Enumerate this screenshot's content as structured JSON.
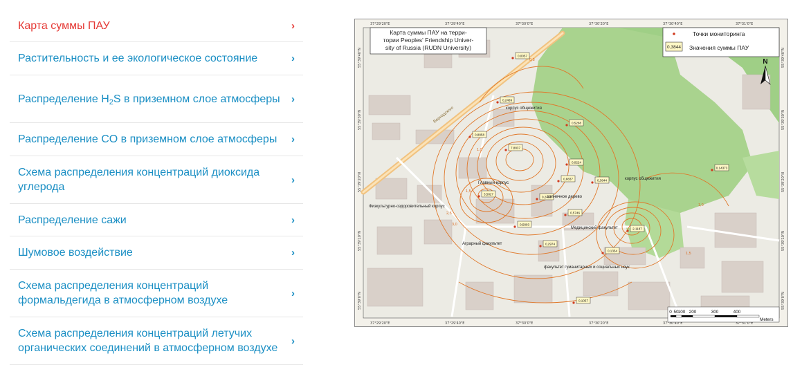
{
  "menu": [
    {
      "label": "Карта суммы ПАУ",
      "active": true
    },
    {
      "label": "Растительность и ее экологическое состояние"
    },
    {
      "label_pre": "Распределение H",
      "label_sub": "2",
      "label_post": "S в приземном слое атмосферы"
    },
    {
      "label": "Распределение CO в приземном слое атмосферы"
    },
    {
      "label": "Схема распределения концентраций диоксида углерода"
    },
    {
      "label": "Распределение сажи"
    },
    {
      "label": "Шумовое воздействие"
    },
    {
      "label": "Схема распределения концентраций формальдегида в атмосферном воздухе"
    },
    {
      "label": "Схема распределения концентраций летучих органических соединений в атмосферном воздухе"
    }
  ],
  "chevron": "›",
  "map": {
    "title_lines": [
      "Карта суммы ПАУ на терри-",
      "тории Peoples' Friendship Univer-",
      "sity of Russia (RUDN University)"
    ],
    "legend": {
      "point_label": "Точки мониторинга",
      "value_sample": "0,3844",
      "value_label": "Значения суммы ПАУ"
    },
    "north": "N",
    "top_coords": [
      "37°29'20\"E",
      "37°29'40\"E",
      "37°30'0\"E",
      "37°30'20\"E",
      "37°30'40\"E",
      "37°31'0\"E"
    ],
    "bottom_coords": [
      "37°29'20\"E",
      "37°29'40\"E",
      "37°30'0\"E",
      "37°30'20\"E",
      "37°30'40\"E",
      "37°31'0\"E"
    ],
    "left_coords": [
      "55°39'40\"N",
      "55°39'30\"N",
      "55°39'20\"N",
      "55°39'10\"N",
      "55°39'0\"N"
    ],
    "right_coords": [
      "55°39'40\"N",
      "55°39'30\"N",
      "55°39'20\"N",
      "55°39'10\"N",
      "55°39'0\"N"
    ],
    "monitoring_values": [
      {
        "value": "0,0057"
      },
      {
        "value": "0,2469"
      },
      {
        "value": "0,5288"
      },
      {
        "value": "0,8858"
      },
      {
        "value": "7,8837"
      },
      {
        "value": "0,0224"
      },
      {
        "value": "0,14373"
      },
      {
        "value": "0,3844"
      },
      {
        "value": "0,8837"
      },
      {
        "value": "3,5827"
      },
      {
        "value": "0,2488"
      },
      {
        "value": "0,5746"
      },
      {
        "value": "0,5803"
      },
      {
        "value": "2,1187"
      },
      {
        "value": "0,2974"
      },
      {
        "value": "0,1354"
      },
      {
        "value": "0,1057"
      }
    ],
    "building_labels": [
      "корпус общежития",
      "Главный корпус",
      "солнечное дерево",
      "корпус общежития",
      "Физкультурно-оздоровительный корпус",
      "Медицинский факультет",
      "Аграрный факультет",
      "факультет гуманитарных и социальных наук"
    ],
    "contour_labels": [
      "0,5",
      "1,0",
      "1,5",
      "2,5",
      "3,0",
      "1,0",
      "1,5"
    ],
    "street_label": "Вернадского",
    "scale": {
      "ticks": [
        "0",
        "50",
        "100",
        "200",
        "300",
        "400"
      ],
      "unit": "Meters"
    },
    "colors": {
      "green": "#a9d38e",
      "contour": "#e0782a",
      "road": "#f1c27f"
    }
  }
}
